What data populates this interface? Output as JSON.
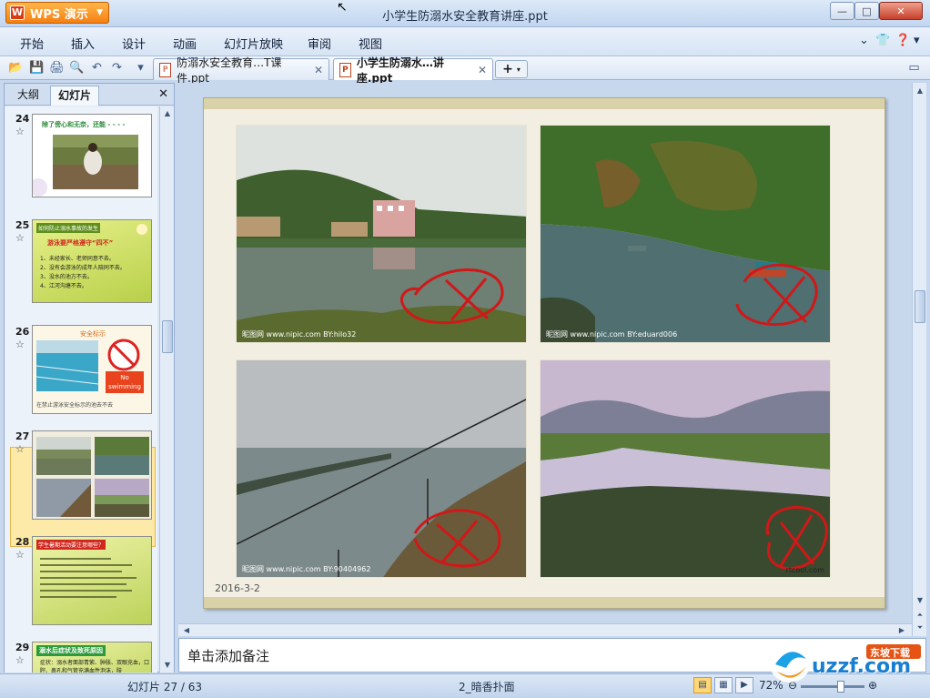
{
  "app": {
    "name": "WPS 演示",
    "window_title": "小学生防溺水安全教育讲座.ppt"
  },
  "menu": {
    "items": [
      "开始",
      "插入",
      "设计",
      "动画",
      "幻灯片放映",
      "审阅",
      "视图"
    ]
  },
  "doc_tabs": [
    {
      "label": "防溺水安全教育…T课件.ppt",
      "active": false
    },
    {
      "label": "小学生防溺水…讲座.ppt",
      "active": true
    }
  ],
  "left_panel": {
    "tabs": [
      "大纲",
      "幻灯片"
    ],
    "active_tab": "幻灯片",
    "slides": [
      {
        "num": "24",
        "title": "除了傍心和无奈，还能 - - - -"
      },
      {
        "num": "25",
        "title": "如何防止溺水事故的发生",
        "subtitle": "游泳要严格遵守“四不”",
        "lines": [
          "1、未经家长、老师同意不去。",
          "2、没有会游泳的成年人陪同不去。",
          "3、没水的池方不去。",
          "4、江河沟塘不去。"
        ]
      },
      {
        "num": "26",
        "title": "安全标示",
        "sign": "No swimming",
        "caption": "在禁止游泳安全标示的池去不去"
      },
      {
        "num": "27",
        "selected": true
      },
      {
        "num": "28",
        "title": "学生暑期活动要注意哪些？"
      },
      {
        "num": "29",
        "title": "溺水后症状及致死原因",
        "text": "症状：溺水者面部青紫、肿胀、双眼充血，口腔、鼻孔和气管充满血性泡沫，肢"
      }
    ]
  },
  "slide": {
    "date": "2016-3-2",
    "photo_watermarks": [
      "昵图网 www.nipic.com  BY:hilo32",
      "昵图网 www.nipic.com  BY:eduard006",
      "昵图网 www.nipic.com  BY:90404962",
      "rtcool.com"
    ]
  },
  "notes": {
    "placeholder": "单击添加备注"
  },
  "status": {
    "slide_counter": "幻灯片 27 / 63",
    "theme": "2_暗香扑面",
    "zoom": "72%"
  },
  "watermark": {
    "brand": "uzzf.com",
    "tag": "东坡下载"
  }
}
